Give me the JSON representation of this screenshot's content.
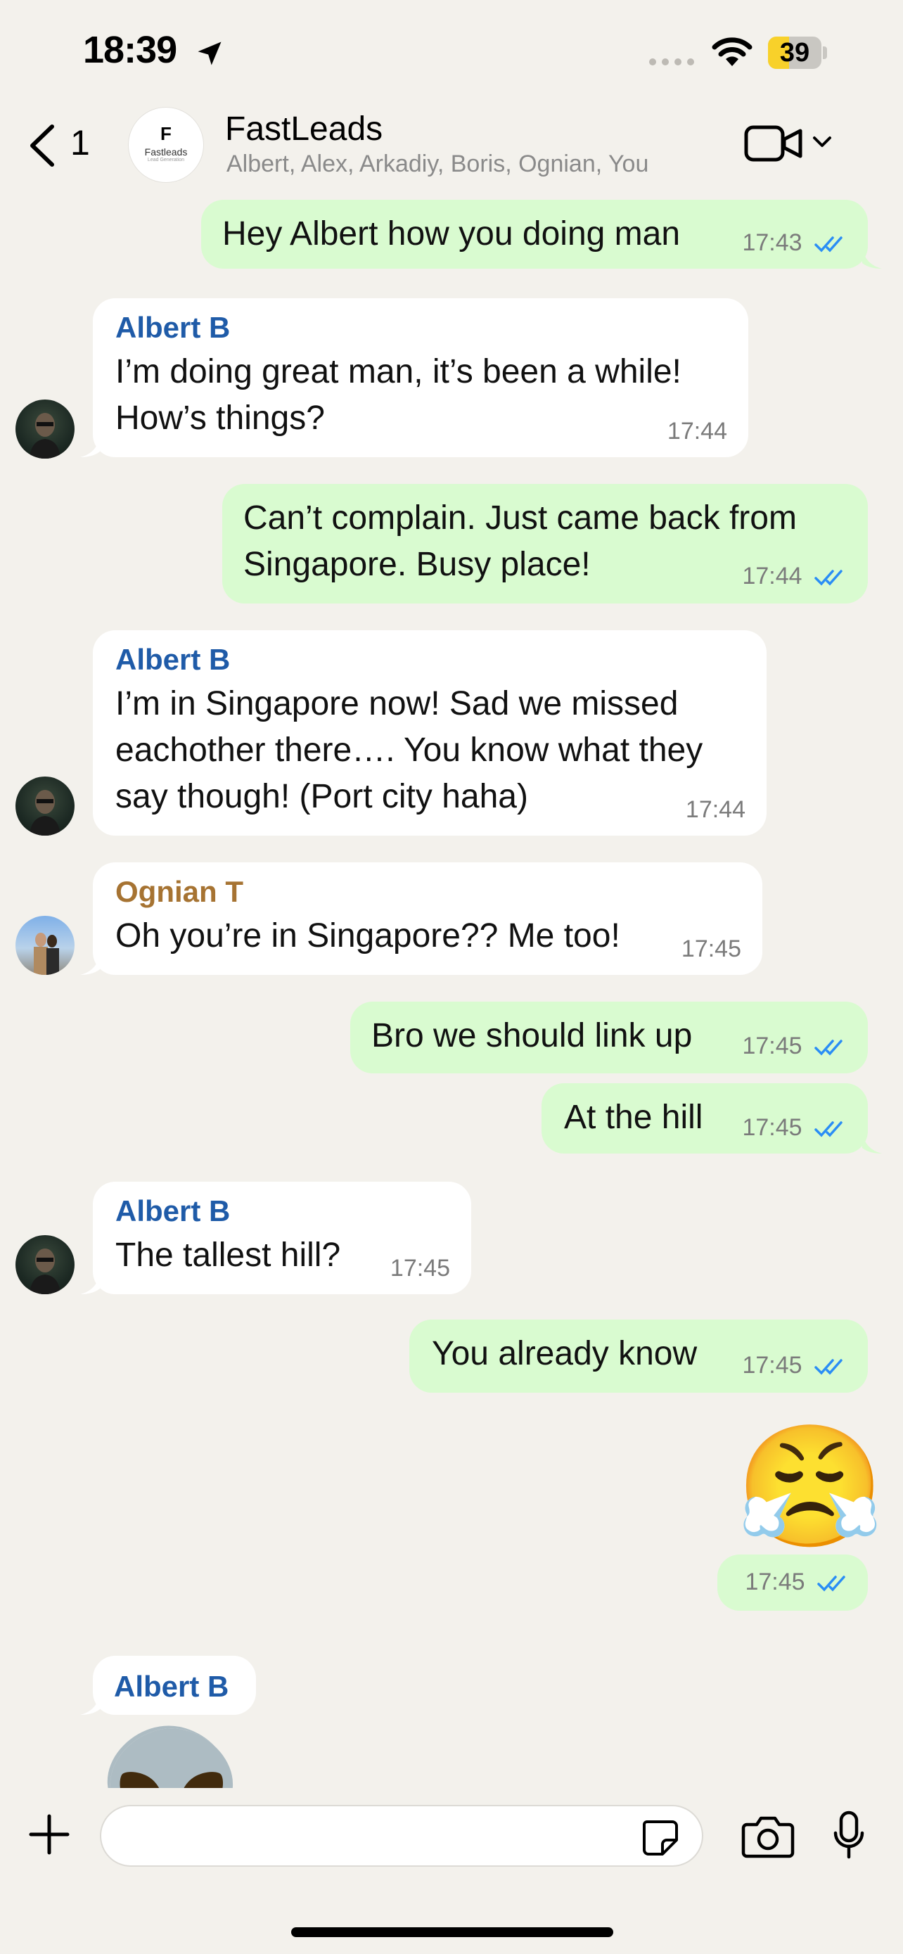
{
  "status_bar": {
    "time": "18:39",
    "battery_level": 39,
    "battery_text": "39"
  },
  "header": {
    "back_count": "1",
    "avatar_initial": "F",
    "avatar_brand": "Fastleads",
    "avatar_tagline": "Lead Generation",
    "title": "FastLeads",
    "members": "Albert, Alex, Arkadiy, Boris, Ognian, You"
  },
  "messages": [
    {
      "dir": "out",
      "text": "Hey Albert how you doing man",
      "time": "17:43",
      "status": "read"
    },
    {
      "dir": "in",
      "sender": "Albert B",
      "sender_color": "#1f5ba8",
      "lines": [
        "I’m doing great man, it’s been a while!",
        "How’s things?"
      ],
      "time": "17:44"
    },
    {
      "dir": "out",
      "lines": [
        "Can’t complain. Just came back from",
        "Singapore. Busy place!"
      ],
      "time": "17:44",
      "status": "read"
    },
    {
      "dir": "in",
      "sender": "Albert B",
      "sender_color": "#1f5ba8",
      "lines": [
        "I’m in Singapore now! Sad we missed",
        "eachother there…. You know what they",
        "say though! (Port city haha)"
      ],
      "time": "17:44"
    },
    {
      "dir": "in",
      "sender": "Ognian T",
      "sender_color": "#a67332",
      "text": "Oh you’re in Singapore?? Me too!",
      "time": "17:45"
    },
    {
      "dir": "out",
      "text": "Bro we should link up",
      "time": "17:45",
      "status": "read"
    },
    {
      "dir": "out",
      "text": "At the hill",
      "time": "17:45",
      "status": "read"
    },
    {
      "dir": "in",
      "sender": "Albert B",
      "sender_color": "#1f5ba8",
      "text": "The tallest hill?",
      "time": "17:45"
    },
    {
      "dir": "out",
      "text": "You already know",
      "time": "17:45",
      "status": "read"
    },
    {
      "dir": "out",
      "emoji": "😤",
      "time": "17:45",
      "status": "read"
    },
    {
      "dir": "in",
      "sender": "Albert B",
      "sender_color": "#1f5ba8",
      "emoji": "👽"
    }
  ],
  "colors": {
    "outgoing_bubble": "#d9fbd0",
    "incoming_bubble": "#ffffff",
    "read_ticks": "#2a8df5",
    "background": "#f3f1ec"
  },
  "input": {
    "placeholder": ""
  }
}
